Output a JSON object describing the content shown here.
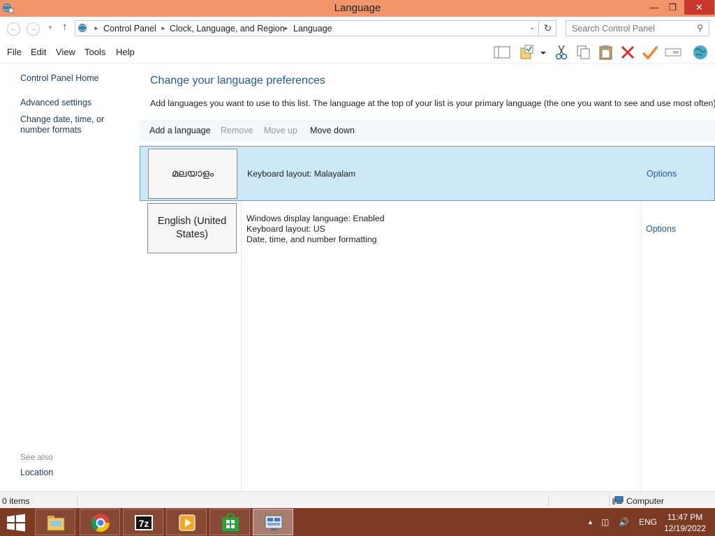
{
  "window": {
    "title": "Language"
  },
  "address": {
    "crumbs": [
      "Control Panel",
      "Clock, Language, and Region",
      "Language"
    ],
    "search_placeholder": "Search Control Panel"
  },
  "menu": [
    "File",
    "Edit",
    "View",
    "Tools",
    "Help"
  ],
  "toolbar_icons": [
    "layout-icon",
    "properties-icon",
    "dropdown-icon",
    "cut-icon",
    "copy-icon",
    "paste-icon",
    "delete-icon",
    "check-icon",
    "rename-icon",
    "globe-icon"
  ],
  "sidebar": {
    "links": [
      "Control Panel Home",
      "Advanced settings",
      "Change date, time, or number formats"
    ],
    "see_also_label": "See also",
    "see_also_links": [
      "Location"
    ]
  },
  "main": {
    "heading": "Change your language preferences",
    "description": "Add languages you want to use to this list. The language at the top of your list is your primary language (the one you want to see and use most often).",
    "actions": {
      "add": "Add a language",
      "remove": "Remove",
      "move_up": "Move up",
      "move_down": "Move down"
    },
    "languages": [
      {
        "tile": "മലയാളം",
        "details": [
          "Keyboard layout: Malayalam"
        ],
        "options": "Options",
        "selected": true
      },
      {
        "tile": "English (United States)",
        "details": [
          "Windows display language: Enabled",
          "Keyboard layout: US",
          "Date, time, and number formatting"
        ],
        "options": "Options",
        "selected": false
      }
    ]
  },
  "statusbar": {
    "items": "0 items",
    "location": "Computer"
  },
  "taskbar": {
    "apps": [
      "file-explorer-icon",
      "chrome-icon",
      "7zip-icon",
      "media-player-icon",
      "store-icon",
      "control-panel-icon"
    ],
    "language": "ENG",
    "time": "11:47 PM",
    "date": "12/19/2022"
  },
  "colors": {
    "titlebar": "#f0946a",
    "taskbar": "#7c3a22",
    "selection": "#cde8f7",
    "link": "#1e5aa0"
  }
}
